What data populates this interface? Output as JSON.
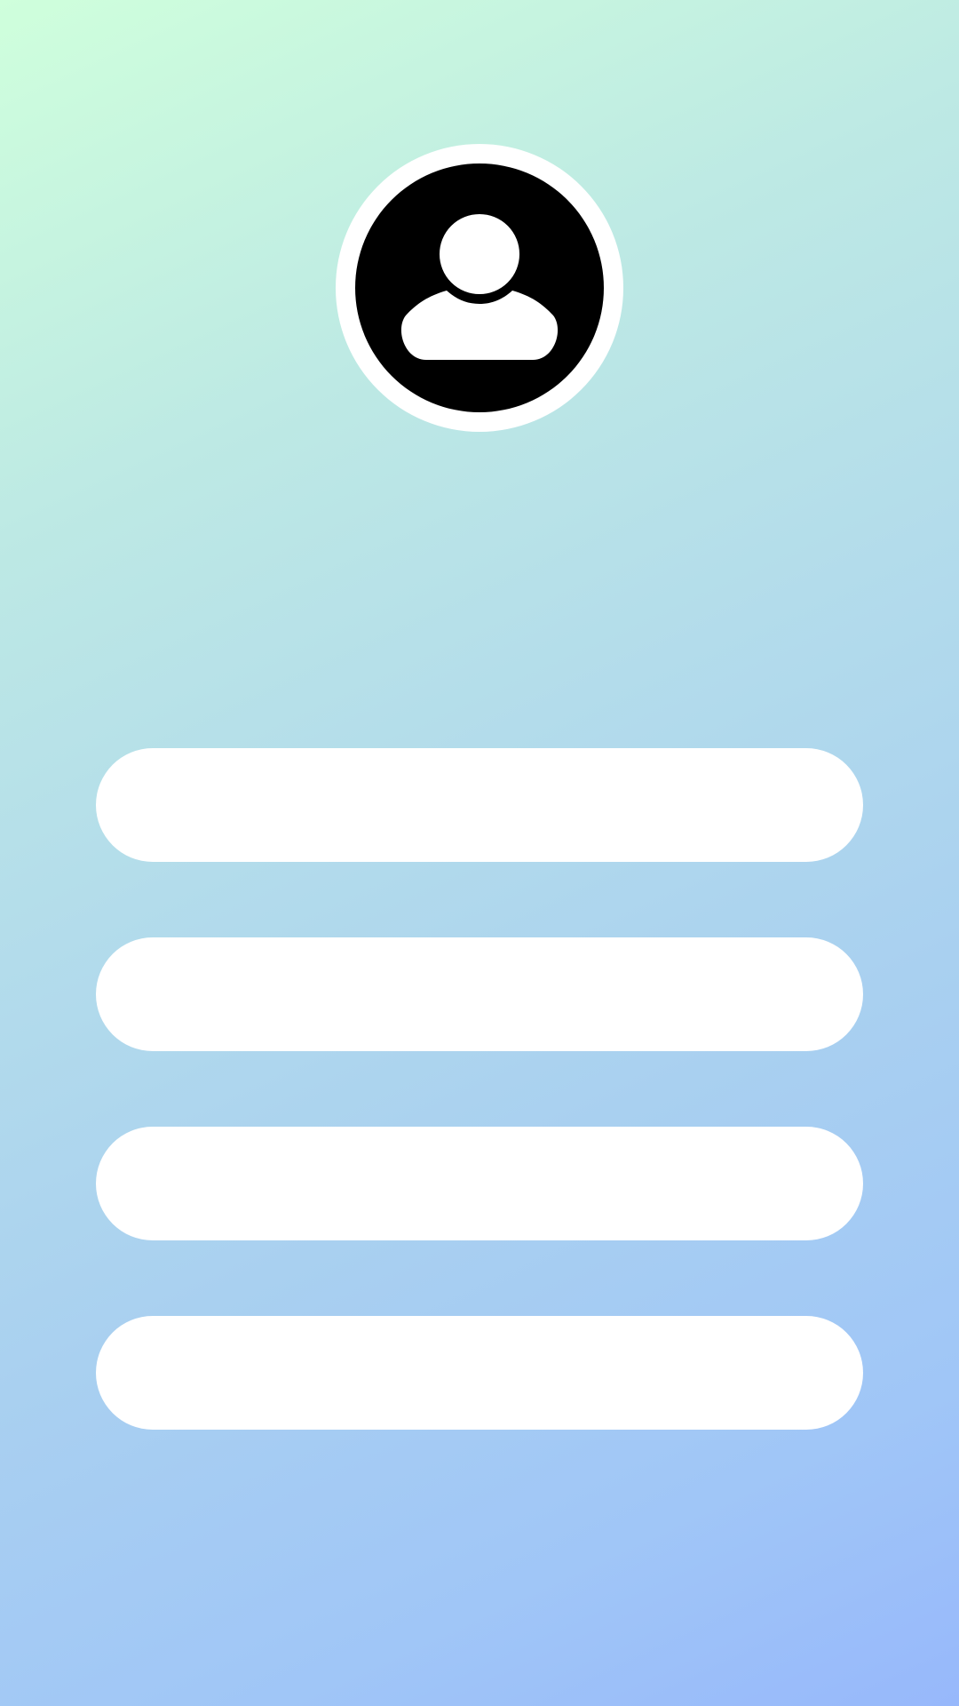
{
  "profile": {
    "avatar_icon": "user-silhouette-icon",
    "ring_color": "#ffffff",
    "avatar_bg": "#000000"
  },
  "fields": [
    {
      "value": ""
    },
    {
      "value": ""
    },
    {
      "value": ""
    },
    {
      "value": ""
    }
  ],
  "theme": {
    "gradient_start": "#cfffdc",
    "gradient_end": "#97b8fb",
    "field_bg": "#ffffff"
  }
}
